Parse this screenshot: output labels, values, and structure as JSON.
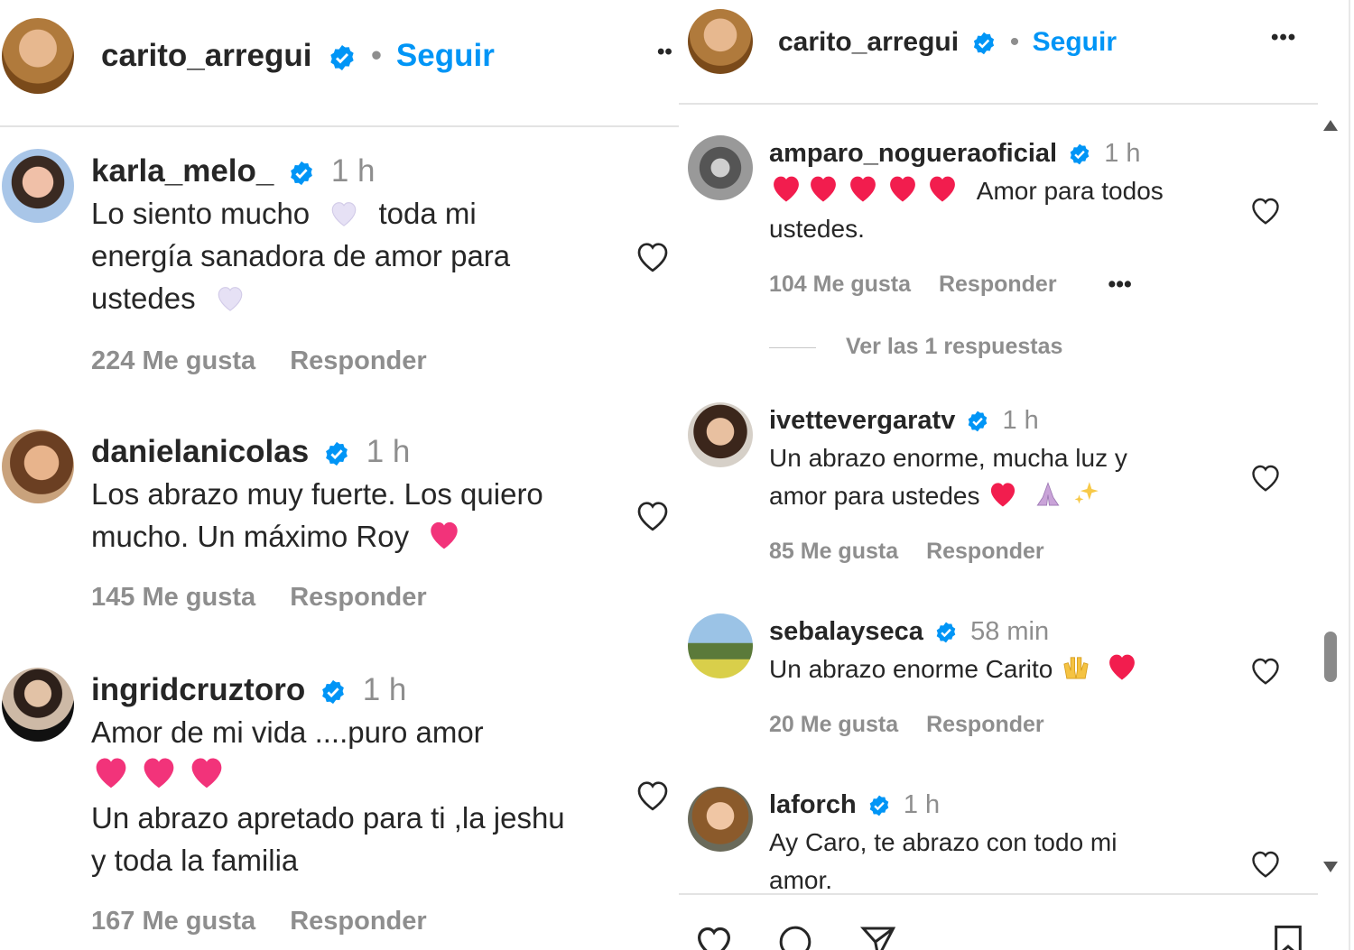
{
  "colors": {
    "accent": "#0095f6",
    "heart": "#ff2d55",
    "verified": "#0095f6",
    "muted": "#8e8e8e"
  },
  "left": {
    "header": {
      "username": "carito_arregui",
      "dot": "•",
      "follow": "Seguir",
      "more": "••"
    },
    "comments": [
      {
        "user": "karla_melo_",
        "time": "1 h",
        "lines": [
          "Lo siento mucho",
          "toda mi",
          "energía sanadora de amor para",
          "ustedes"
        ],
        "likes": "224 Me gusta",
        "reply": "Responder"
      },
      {
        "user": "danielanicolas",
        "time": "1 h",
        "lines": [
          "Los abrazo muy fuerte. Los quiero",
          "mucho. Un máximo Roy"
        ],
        "likes": "145 Me gusta",
        "reply": "Responder"
      },
      {
        "user": "ingridcruztoro",
        "time": "1 h",
        "lines": [
          "Amor de mi vida ....puro amor",
          "Un abrazo apretado para ti ,la jeshu",
          "y toda la familia"
        ],
        "likes": "167 Me gusta",
        "reply": "Responder"
      }
    ]
  },
  "right": {
    "header": {
      "username": "carito_arregui",
      "dot": "•",
      "follow": "Seguir",
      "more": "•••"
    },
    "comments": [
      {
        "user": "amparo_nogueraoficial",
        "time": "1 h",
        "lines": [
          "Amor para todos",
          "ustedes."
        ],
        "likes": "104 Me gusta",
        "reply": "Responder",
        "more": "•••",
        "view_replies": "Ver las 1 respuestas"
      },
      {
        "user": "ivettevergaratv",
        "time": "1 h",
        "lines": [
          "Un abrazo enorme, mucha luz y",
          "amor para ustedes"
        ],
        "likes": "85 Me gusta",
        "reply": "Responder"
      },
      {
        "user": "sebalayseca",
        "time": "58 min",
        "lines": [
          "Un abrazo enorme Carito"
        ],
        "likes": "20 Me gusta",
        "reply": "Responder"
      },
      {
        "user": "laforch",
        "time": "1 h",
        "lines": [
          "Ay Caro, te abrazo con todo mi",
          "amor."
        ]
      }
    ]
  },
  "icons": [
    "verified-badge-icon",
    "heart-outline-icon",
    "comment-icon",
    "share-icon",
    "save-icon",
    "more-icon",
    "scroll-up-icon",
    "scroll-down-icon"
  ]
}
